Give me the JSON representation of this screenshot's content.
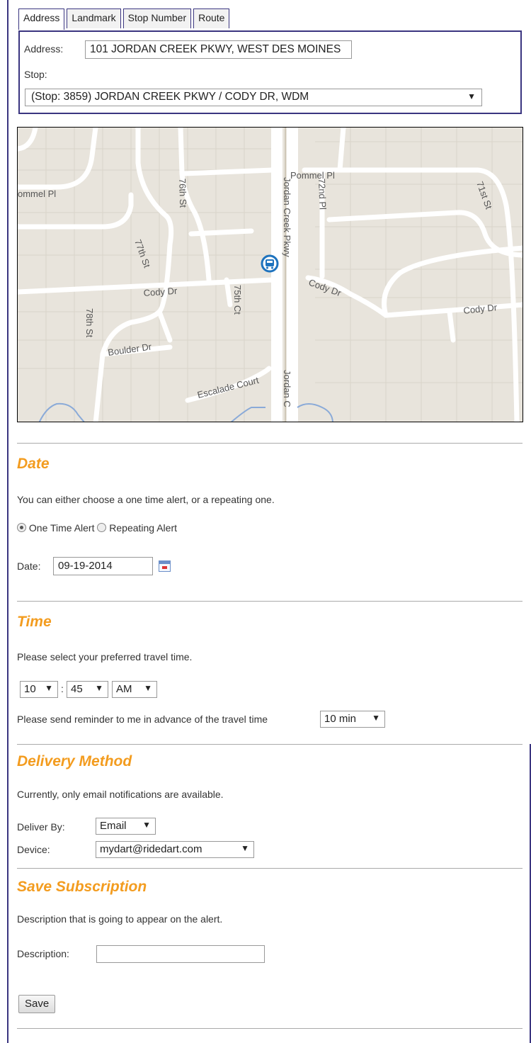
{
  "tabs": [
    "Address",
    "Landmark",
    "Stop Number",
    "Route"
  ],
  "address": {
    "label": "Address:",
    "value": "101 JORDAN CREEK PKWY, WEST DES MOINES"
  },
  "stop": {
    "label": "Stop:",
    "value": "(Stop: 3859) JORDAN CREEK PKWY / CODY DR, WDM"
  },
  "map": {
    "labels": {
      "pommel_pl_1": "Pommel Pl",
      "pommel_pl_2": "ommel Pl",
      "st_76": "76th St",
      "st_72nd": "72nd Pl",
      "st_71": "71st St",
      "st_77": "77th St",
      "jordan_creek": "Jordan Creek Pkwy",
      "cody_dr_1": "Cody Dr",
      "cody_dr_2": "Cody Dr",
      "cody_dr_3": "Cody Dr",
      "ct_75": "75th Ct",
      "st_78": "78th St",
      "boulder": "Boulder Dr",
      "escalade": "Escalade Court",
      "jordan_c": "Jordan C"
    }
  },
  "date_section": {
    "heading": "Date",
    "description": "You can either choose a one time alert, or a repeating one.",
    "one_time": "One Time Alert",
    "repeating": "Repeating Alert",
    "date_label": "Date:",
    "date_value": "09-19-2014"
  },
  "time_section": {
    "heading": "Time",
    "description": "Please select your preferred travel time.",
    "hour": "10",
    "minute": "45",
    "ampm": "AM",
    "colon": ":",
    "reminder_text": "Please send reminder to me in advance of the travel time",
    "reminder_value": "10 min"
  },
  "delivery_section": {
    "heading": "Delivery Method",
    "description": "Currently, only email notifications are available.",
    "deliver_by_label": "Deliver By:",
    "deliver_by_value": "Email",
    "device_label": "Device:",
    "device_value": "mydart@ridedart.com"
  },
  "save_section": {
    "heading": "Save Subscription",
    "description": "Description that is going to appear on the alert.",
    "description_label": "Description:",
    "description_value": "",
    "save_button": "Save"
  },
  "colors": {
    "accent": "#f39c1f",
    "border": "#3a3580",
    "map_bg": "#e8e4dc",
    "bus_icon": "#1e73be"
  }
}
